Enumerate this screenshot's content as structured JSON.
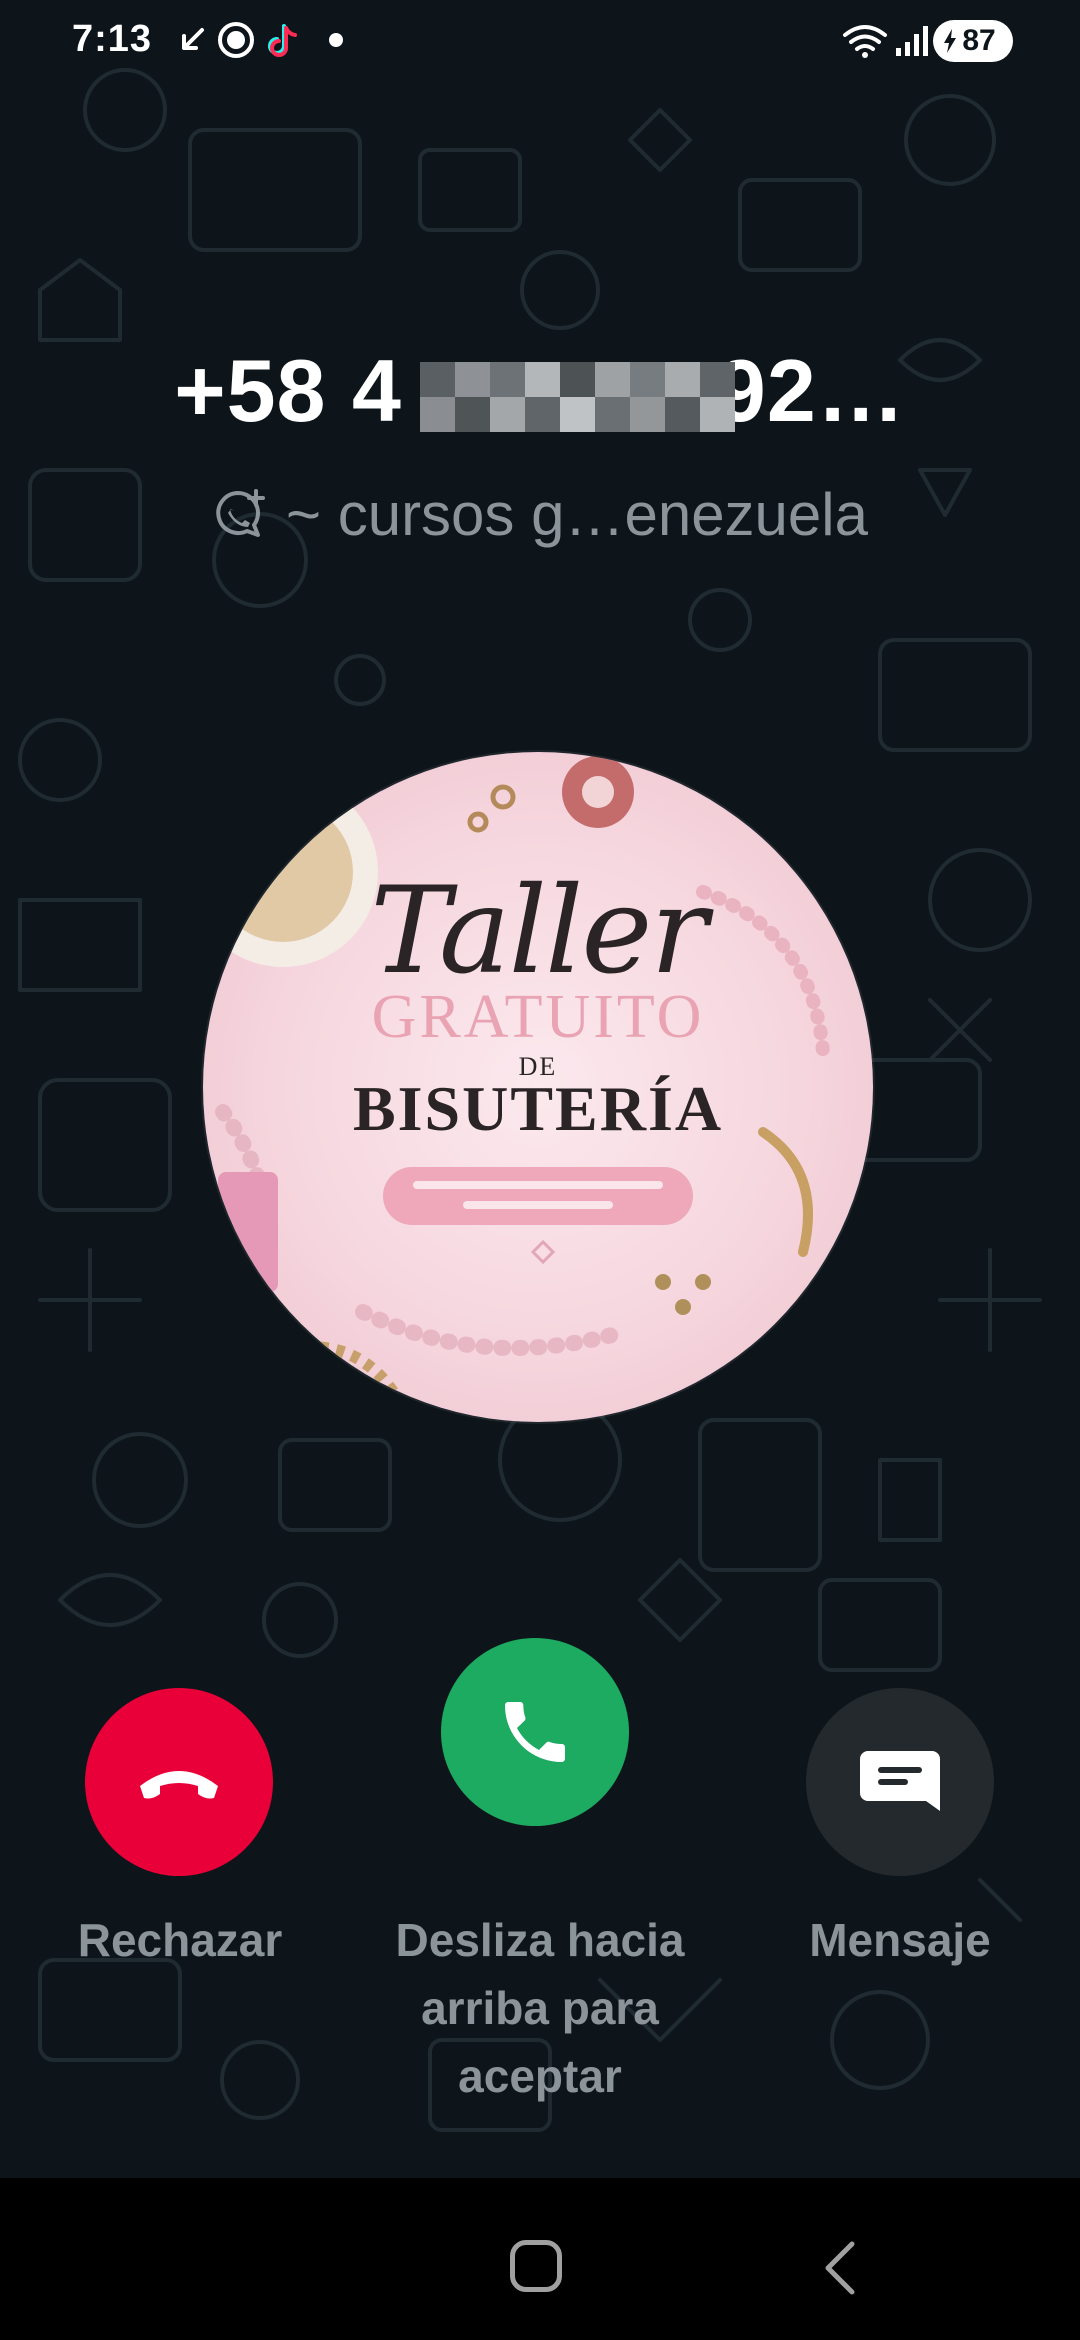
{
  "status_bar": {
    "time": "7:13",
    "battery_level": "87",
    "icons": [
      "missed-call-arrow-icon",
      "whatsapp-icon",
      "tiktok-icon",
      "notification-dot-icon",
      "wifi-icon",
      "signal-icon",
      "battery-icon"
    ]
  },
  "call": {
    "caller_number_visible_start": "+58 4",
    "caller_number_visible_end": "92…",
    "caller_number_redacted": true,
    "group_name": "~ cursos g…enezuela",
    "group_icon": "whatsapp-group-add-icon",
    "avatar": {
      "script_title": "Taller",
      "line2": "GRATUITO",
      "line3": "DE",
      "line4": "BISUTERÍA"
    }
  },
  "actions": {
    "decline_label": "Rechazar",
    "accept_label": "Desliza hacia arriba para aceptar",
    "message_label": "Mensaje",
    "decline_icon": "phone-hangup-icon",
    "accept_icon": "phone-icon",
    "message_icon": "message-icon"
  },
  "nav_bar": {
    "icons": [
      "home-icon",
      "back-icon"
    ]
  },
  "colors": {
    "background": "#0d151b",
    "decline": "#ea0038",
    "accept": "#1daa61",
    "message": "#23292d",
    "secondary_text": "#8a9499"
  }
}
